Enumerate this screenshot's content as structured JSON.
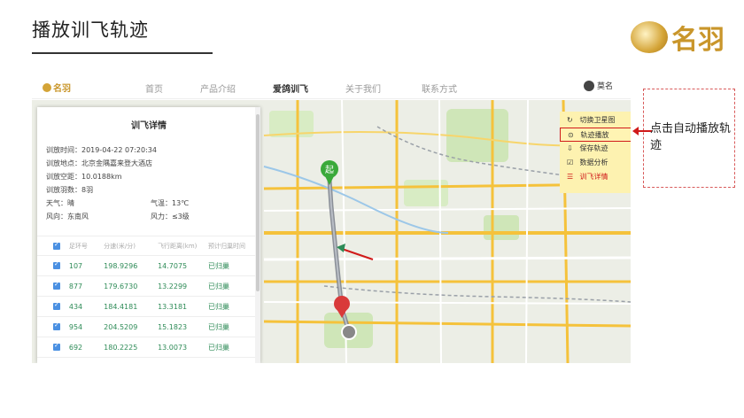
{
  "page": {
    "title": "播放训飞轨迹",
    "brand_text": "名羽"
  },
  "nav": {
    "logo_text": "名羽",
    "items": [
      {
        "label": "首页",
        "active": false
      },
      {
        "label": "产品介绍",
        "active": false
      },
      {
        "label": "爱鸽训飞",
        "active": true
      },
      {
        "label": "关于我们",
        "active": false
      },
      {
        "label": "联系方式",
        "active": false
      }
    ],
    "user_name": "莫名"
  },
  "panel": {
    "title": "训飞详情",
    "time": "训放时间：2019-04-22 07:20:34",
    "place": "训放地点：北京金隅嘉来登大酒店",
    "distance": "训放空距：10.0188km",
    "count": "训放羽数：8羽",
    "weather": "天气：晴",
    "temp": "气温：13℃",
    "wind_dir": "风向：东南风",
    "wind_force": "风力：≤3级",
    "table": {
      "headers": [
        "足环号",
        "分速(米/分)",
        "飞行距离(km)",
        "预计归巢时间"
      ],
      "rows": [
        [
          "107",
          "198.9296",
          "14.7075",
          "已归巢"
        ],
        [
          "877",
          "179.6730",
          "13.2299",
          "已归巢"
        ],
        [
          "434",
          "184.4181",
          "13.3181",
          "已归巢"
        ],
        [
          "954",
          "204.5209",
          "15.1823",
          "已归巢"
        ],
        [
          "692",
          "180.2225",
          "13.0073",
          "已归巢"
        ]
      ]
    }
  },
  "menu": {
    "items": [
      {
        "label": "切换卫星图",
        "icon": "refresh-icon",
        "glyph": "↻"
      },
      {
        "label": "轨迹播放",
        "icon": "play-icon",
        "glyph": "⊙"
      },
      {
        "label": "保存轨迹",
        "icon": "save-icon",
        "glyph": "⇩"
      },
      {
        "label": "数据分析",
        "icon": "analysis-icon",
        "glyph": "☑"
      },
      {
        "label": "训飞详情",
        "icon": "list-icon",
        "glyph": "☰"
      }
    ]
  },
  "map_labels": {
    "start_marker": "起"
  },
  "callout": {
    "text": "点击自动播放轨迹"
  },
  "colors": {
    "brand_gold": "#c9962b",
    "highlight_red": "#d01a1a",
    "menu_bg": "#fdf2b0",
    "data_green": "#2e8b57",
    "checkbox_blue": "#4a90e2"
  }
}
